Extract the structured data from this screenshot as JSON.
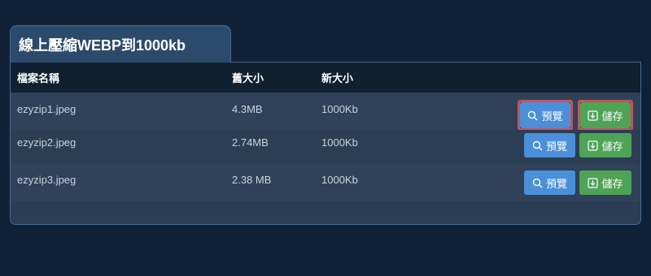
{
  "title": "線上壓縮WEBP到1000kb",
  "table": {
    "headers": {
      "name": "檔案名稱",
      "old_size": "舊大小",
      "new_size": "新大小"
    },
    "rows": [
      {
        "name": "ezyzip1.jpeg",
        "old_size": "4.3MB",
        "new_size": "1000Kb",
        "preview": "預覽",
        "save": "儲存"
      },
      {
        "name": "ezyzip2.jpeg",
        "old_size": "2.74MB",
        "new_size": "1000Kb",
        "preview": "預覽",
        "save": "儲存"
      },
      {
        "name": "ezyzip3.jpeg",
        "old_size": "2.38 MB",
        "new_size": "1000Kb",
        "preview": "預覽",
        "save": "儲存"
      }
    ]
  },
  "icons": {
    "preview": "search-icon",
    "save": "download-icon"
  },
  "colors": {
    "background": "#0f2137",
    "panel": "#2a3d55",
    "header_row": "#0f2030",
    "preview_button": "#4a8fd9",
    "save_button": "#4ea356",
    "highlight": "#c4535f"
  }
}
